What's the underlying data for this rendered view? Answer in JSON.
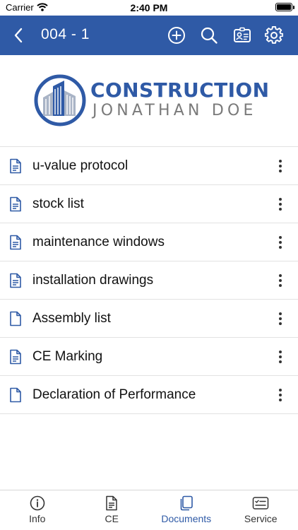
{
  "status_bar": {
    "carrier": "Carrier",
    "time": "2:40 PM"
  },
  "nav": {
    "title": "004 - 1",
    "icons": [
      "back-icon",
      "add-icon",
      "search-icon",
      "contact-card-icon",
      "gear-icon"
    ]
  },
  "logo": {
    "brand": "CONSTRUCTION",
    "name": "JONATHAN DOE"
  },
  "documents": [
    {
      "label": "u-value protocol"
    },
    {
      "label": "stock list"
    },
    {
      "label": "maintenance windows"
    },
    {
      "label": "installation drawings"
    },
    {
      "label": "Assembly list"
    },
    {
      "label": "CE Marking"
    },
    {
      "label": "Declaration of Performance"
    }
  ],
  "tabs": [
    {
      "label": "Info",
      "icon": "info-icon",
      "active": false
    },
    {
      "label": "CE",
      "icon": "document-icon",
      "active": false
    },
    {
      "label": "Documents",
      "icon": "documents-icon",
      "active": true
    },
    {
      "label": "Service",
      "icon": "checklist-icon",
      "active": false
    }
  ],
  "colors": {
    "accent": "#2f5aa6",
    "logo_gray": "#7a7a7a",
    "divider": "#e2e2e2"
  }
}
